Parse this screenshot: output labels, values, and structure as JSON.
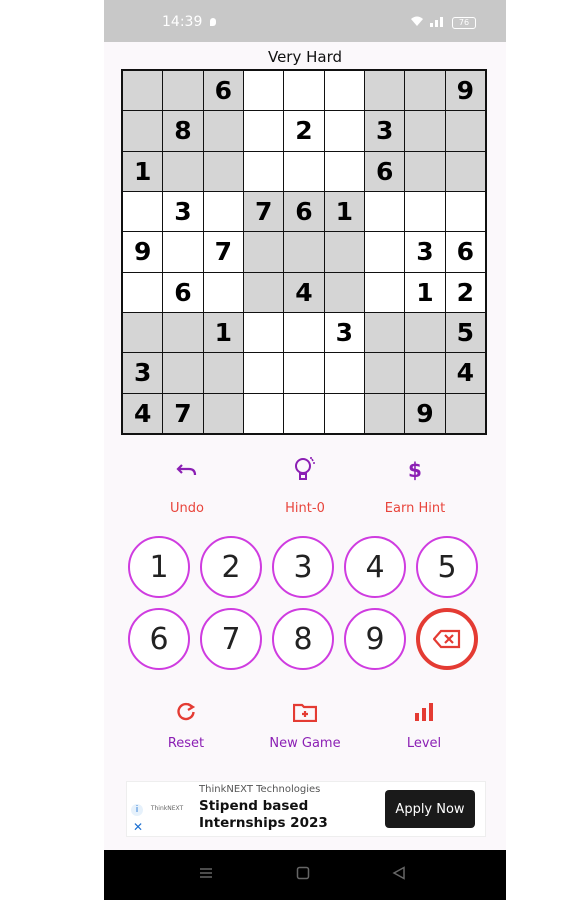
{
  "status_bar": {
    "time": "14:39",
    "battery": "76"
  },
  "title": "Very Hard",
  "board": [
    [
      "",
      "",
      "6",
      "",
      "",
      "",
      "",
      "",
      "9"
    ],
    [
      "",
      "8",
      "",
      "",
      "2",
      "",
      "3",
      "",
      ""
    ],
    [
      "1",
      "",
      "",
      "",
      "",
      "",
      "6",
      "",
      ""
    ],
    [
      "",
      "3",
      "",
      "7",
      "6",
      "1",
      "",
      "",
      ""
    ],
    [
      "9",
      "",
      "7",
      "",
      "",
      "",
      "",
      "3",
      "6"
    ],
    [
      "",
      "6",
      "",
      "",
      "4",
      "",
      "",
      "1",
      "2"
    ],
    [
      "",
      "",
      "1",
      "",
      "",
      "3",
      "",
      "",
      "5"
    ],
    [
      "3",
      "",
      "",
      "",
      "",
      "",
      "",
      "",
      "4"
    ],
    [
      "4",
      "7",
      "",
      "",
      "",
      "",
      "",
      "9",
      ""
    ]
  ],
  "board_shading": [
    [
      1,
      1,
      1,
      0,
      0,
      0,
      1,
      1,
      1
    ],
    [
      1,
      1,
      1,
      0,
      0,
      0,
      1,
      1,
      1
    ],
    [
      1,
      1,
      1,
      0,
      0,
      0,
      1,
      1,
      1
    ],
    [
      0,
      0,
      0,
      1,
      1,
      1,
      0,
      0,
      0
    ],
    [
      0,
      0,
      0,
      1,
      1,
      1,
      0,
      0,
      0
    ],
    [
      0,
      0,
      0,
      1,
      1,
      1,
      0,
      0,
      0
    ],
    [
      1,
      1,
      1,
      0,
      0,
      0,
      1,
      1,
      1
    ],
    [
      1,
      1,
      1,
      0,
      0,
      0,
      1,
      1,
      1
    ],
    [
      1,
      1,
      1,
      0,
      0,
      0,
      1,
      1,
      1
    ]
  ],
  "tools": {
    "undo": {
      "label": "Undo",
      "icon": "undo-icon"
    },
    "hint": {
      "label": "Hint-0",
      "icon": "lightbulb-icon"
    },
    "earn_hint": {
      "label": "Earn Hint",
      "icon": "dollar-icon"
    }
  },
  "numpad": {
    "keys": [
      "1",
      "2",
      "3",
      "4",
      "5",
      "6",
      "7",
      "8",
      "9"
    ],
    "delete_icon": "backspace-icon"
  },
  "bottom_tools": {
    "reset": {
      "label": "Reset",
      "icon": "refresh-icon"
    },
    "new_game": {
      "label": "New Game",
      "icon": "folder-plus-icon"
    },
    "level": {
      "label": "Level",
      "icon": "bar-chart-icon"
    }
  },
  "ad": {
    "company": "ThinkNEXT Technologies",
    "logo_text": "ThinkNEXT",
    "headline": "Stipend based Internships 2023",
    "cta": "Apply Now"
  },
  "colors": {
    "accent_purple": "#8b1fb4",
    "accent_red": "#e8453c",
    "numpad_border": "#cf3ce0",
    "shaded_cell": "#d5d5d5"
  }
}
